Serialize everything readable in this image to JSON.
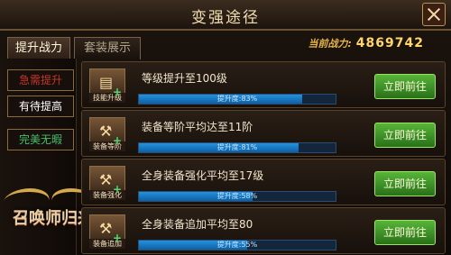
{
  "window": {
    "title": "变强途径"
  },
  "tabs": [
    "提升战力",
    "套装展示"
  ],
  "power": {
    "label": "当前战力:",
    "value": "4869742"
  },
  "filters": [
    "急需提升",
    "有待提高",
    "完美无暇"
  ],
  "logo": {
    "text": "召唤师归来"
  },
  "rows": [
    {
      "task": "等级提升至100级",
      "icon_label": "技能升级",
      "progress_text": "提升度:83%",
      "progress": 83,
      "button": "立即前往"
    },
    {
      "task": "装备等阶平均达至11阶",
      "icon_label": "装备等阶",
      "progress_text": "提升度:81%",
      "progress": 81,
      "button": "立即前往"
    },
    {
      "task": "全身装备强化平均至17级",
      "icon_label": "装备强化",
      "progress_text": "提升度:58%",
      "progress": 58,
      "button": "立即前往"
    },
    {
      "task": "全身装备追加平均至80",
      "icon_label": "装备追加",
      "progress_text": "提升度:55%",
      "progress": 55,
      "button": "立即前往"
    }
  ],
  "colors": {
    "accent": "#e6b447",
    "button": "#57b538",
    "progress": "#2392e0"
  },
  "icons": {
    "close": "close-icon",
    "row_icon": "equipment-icon"
  }
}
